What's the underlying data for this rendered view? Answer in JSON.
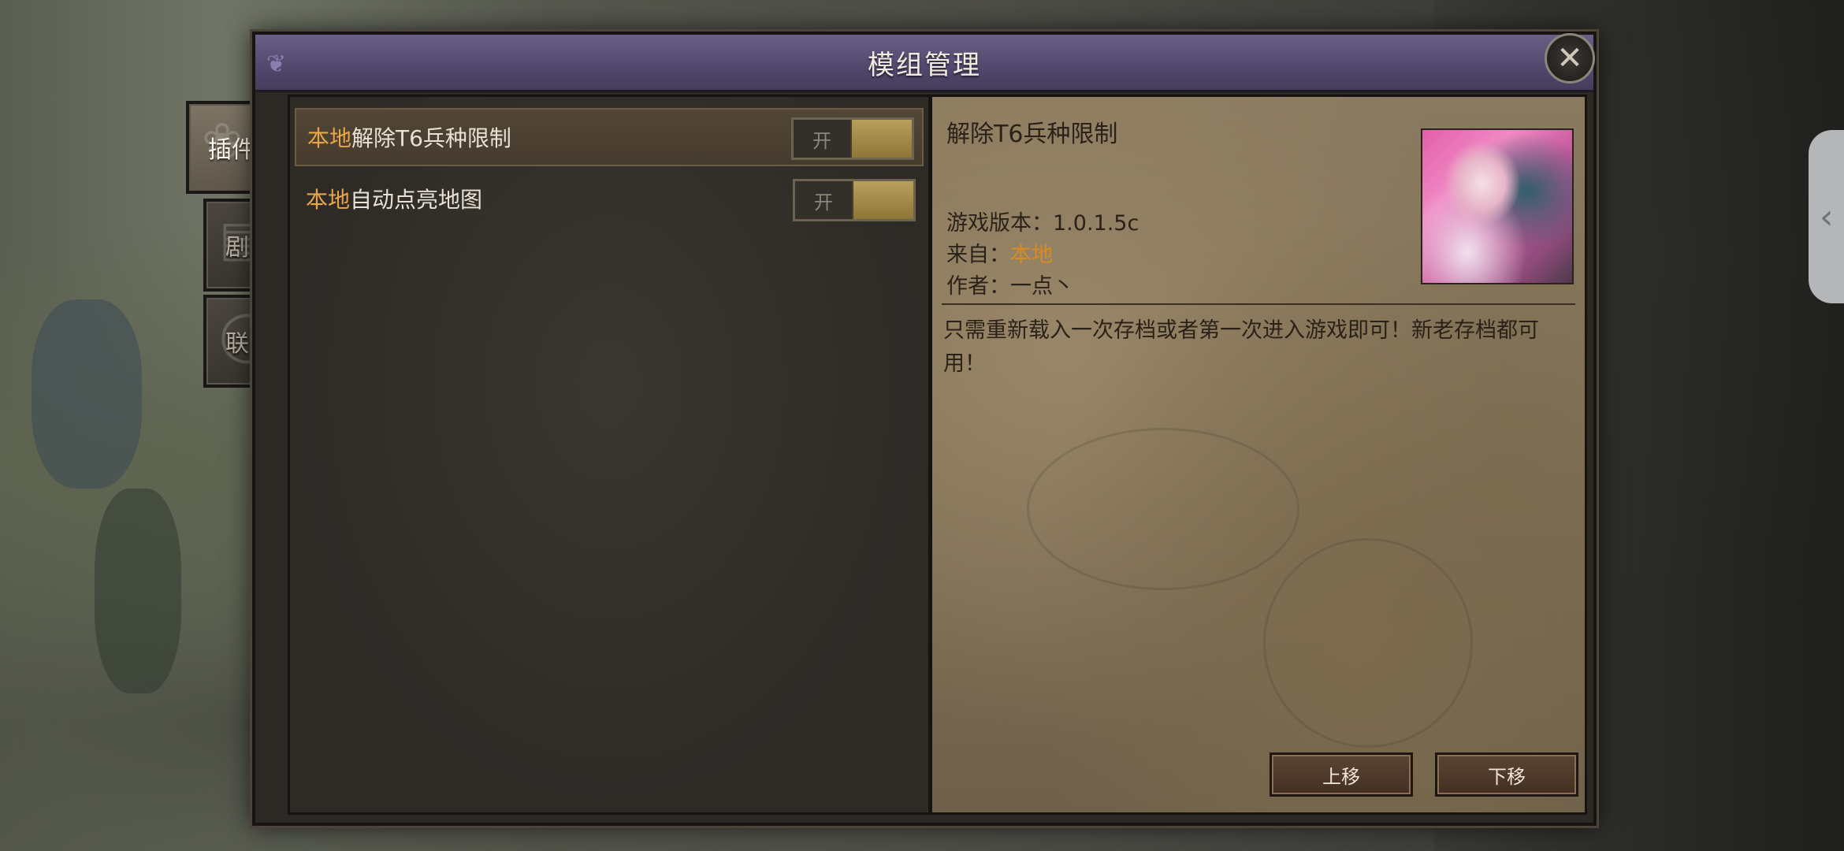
{
  "window": {
    "title": "模组管理"
  },
  "tabs": [
    {
      "label": "插件",
      "active": true
    },
    {
      "label": "剧本",
      "active": false
    },
    {
      "label": "联机",
      "active": false
    }
  ],
  "mods": [
    {
      "source": "本地",
      "name": "解除T6兵种限制",
      "toggle_label": "开",
      "enabled": true,
      "selected": true
    },
    {
      "source": "本地",
      "name": "自动点亮地图",
      "toggle_label": "开",
      "enabled": true,
      "selected": false
    }
  ],
  "detail": {
    "title": "解除T6兵种限制",
    "version_label": "游戏版本：",
    "version": "1.0.1.5c",
    "source_label": "来自：",
    "source": "本地",
    "author_label": "作者：",
    "author": "一点丶",
    "description": "只需重新载入一次存档或者第一次进入游戏即可！新老存档都可用！"
  },
  "actions": {
    "move_up": "上移",
    "move_down": "下移"
  },
  "icons": {
    "close": "close-icon",
    "edge_handle": "chevron-left-icon"
  },
  "colors": {
    "accent_source": "#e8a549",
    "title_bar": "#54496f",
    "toggle_on": "#b79f5c"
  }
}
